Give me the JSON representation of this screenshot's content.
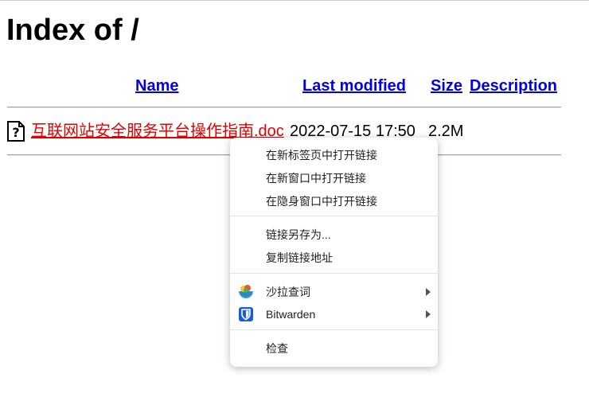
{
  "page": {
    "heading": "Index of /"
  },
  "columns": {
    "name": "Name",
    "last_modified": "Last modified",
    "size": "Size",
    "description": "Description"
  },
  "files": [
    {
      "icon": "unknown-file-icon",
      "name": "互联网站安全服务平台操作指南.doc",
      "modified": "2022-07-15 17:50",
      "size": "2.2M",
      "description": ""
    }
  ],
  "context_menu": {
    "items": {
      "open_new_tab": "在新标签页中打开链接",
      "open_new_window": "在新窗口中打开链接",
      "open_incognito": "在隐身窗口中打开链接",
      "save_link_as": "链接另存为...",
      "copy_link": "复制链接地址",
      "shala_lookup": "沙拉查词",
      "bitwarden": "Bitwarden",
      "inspect": "检查"
    },
    "icons": {
      "shala": "saladict-icon",
      "bitwarden": "bitwarden-shield-icon"
    },
    "colors": {
      "bitwarden_blue": "#175ddc",
      "link_blue": "#0000ee",
      "visited_red": "#e00000"
    }
  }
}
